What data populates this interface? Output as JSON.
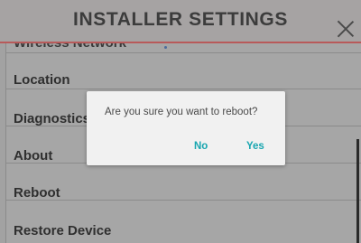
{
  "header": {
    "title": "INSTALLER SETTINGS",
    "close_icon": "close-icon"
  },
  "list": {
    "items": [
      {
        "label": "Wireless Network"
      },
      {
        "label": "Location"
      },
      {
        "label": "Diagnostics"
      },
      {
        "label": "About"
      },
      {
        "label": "Reboot"
      },
      {
        "label": "Restore Device"
      }
    ]
  },
  "dialog": {
    "message": "Are you sure you want to reboot?",
    "no_label": "No",
    "yes_label": "Yes",
    "accent_color": "#18a6b0"
  },
  "colors": {
    "header_divider": "#b85a5a",
    "overlay_dim": "#a2a2a2"
  }
}
